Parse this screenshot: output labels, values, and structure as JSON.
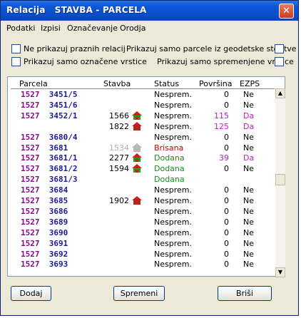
{
  "window": {
    "title": "Relacija   STAVBA - PARCELA",
    "close_glyph": "✕"
  },
  "menu": [
    "Podatki",
    "Izpisi",
    "Označevanje",
    "Orodja"
  ],
  "options": {
    "no_empty_relations": "Ne prikazuj praznih relacij",
    "only_marked_rows": "Prikazuj samo označene vrstice",
    "only_geodetic_parcels": "Prikazuj samo parcele iz geodetske storitve",
    "only_changed_rows": "Prikazuj samo spremenjene vrstice"
  },
  "columns": {
    "parcela": "Parcela",
    "stavba": "Stavba",
    "status": "Status",
    "povrsina": "Površina",
    "ezps": "EZPS"
  },
  "colors": {
    "parcel_ko": "#8a0a8a",
    "parcel_num": "#1a1a9a",
    "status_default": "#000000",
    "status_deleted": "#cc0000",
    "status_added": "#1a8a1a",
    "da": "#c020c0",
    "house_red": "#d21b1b",
    "house_green": "#1aa01a",
    "house_grey": "#b8b8b8",
    "building_grey": "#b0b0b0"
  },
  "rows": [
    {
      "ko": "1527",
      "parcel": "3451/5",
      "building": "",
      "icon": "",
      "status": "Nesprem.",
      "status_type": "default",
      "area": "0",
      "ezps": "Ne"
    },
    {
      "ko": "1527",
      "parcel": "3451/6",
      "building": "",
      "icon": "",
      "status": "Nesprem.",
      "status_type": "default",
      "area": "0",
      "ezps": "Ne"
    },
    {
      "ko": "1527",
      "parcel": "3452/1",
      "building": "1566",
      "icon": "house-red-green",
      "status": "Nesprem.",
      "status_type": "default",
      "area": "115",
      "ezps": "Da"
    },
    {
      "ko": "",
      "parcel": "",
      "building": "1822",
      "icon": "house-red-brown",
      "status": "Nesprem.",
      "status_type": "default",
      "area": "125",
      "ezps": "Da"
    },
    {
      "ko": "1527",
      "parcel": "3680/4",
      "building": "",
      "icon": "",
      "status": "Nesprem.",
      "status_type": "default",
      "area": "0",
      "ezps": "Ne"
    },
    {
      "ko": "1527",
      "parcel": "3681",
      "building": "1534",
      "icon": "house-grey",
      "status": "Brisana",
      "status_type": "deleted",
      "area": "0",
      "ezps": "Ne",
      "building_grey": true
    },
    {
      "ko": "1527",
      "parcel": "3681/1",
      "building": "2277",
      "icon": "house-red-green",
      "status": "Dodana",
      "status_type": "added",
      "area": "39",
      "ezps": "Da"
    },
    {
      "ko": "1527",
      "parcel": "3681/2",
      "building": "1594",
      "icon": "house-red-green",
      "status": "Dodana",
      "status_type": "added",
      "area": "0",
      "ezps": "Ne"
    },
    {
      "ko": "1527",
      "parcel": "3681/3",
      "building": "",
      "icon": "",
      "status": "Dodana",
      "status_type": "added",
      "area": "",
      "ezps": ""
    },
    {
      "ko": "1527",
      "parcel": "3684",
      "building": "",
      "icon": "",
      "status": "Nesprem.",
      "status_type": "default",
      "area": "0",
      "ezps": "Ne"
    },
    {
      "ko": "1527",
      "parcel": "3685",
      "building": "1902",
      "icon": "house-red-brown",
      "status": "Nesprem.",
      "status_type": "default",
      "area": "0",
      "ezps": "Ne"
    },
    {
      "ko": "1527",
      "parcel": "3686",
      "building": "",
      "icon": "",
      "status": "Nesprem.",
      "status_type": "default",
      "area": "0",
      "ezps": "Ne"
    },
    {
      "ko": "1527",
      "parcel": "3689",
      "building": "",
      "icon": "",
      "status": "Nesprem.",
      "status_type": "default",
      "area": "0",
      "ezps": "Ne"
    },
    {
      "ko": "1527",
      "parcel": "3690",
      "building": "",
      "icon": "",
      "status": "Nesprem.",
      "status_type": "default",
      "area": "0",
      "ezps": "Ne"
    },
    {
      "ko": "1527",
      "parcel": "3691",
      "building": "",
      "icon": "",
      "status": "Nesprem.",
      "status_type": "default",
      "area": "0",
      "ezps": "Ne"
    },
    {
      "ko": "1527",
      "parcel": "3692",
      "building": "",
      "icon": "",
      "status": "Nesprem.",
      "status_type": "default",
      "area": "0",
      "ezps": "Ne"
    },
    {
      "ko": "1527",
      "parcel": "3693",
      "building": "",
      "icon": "",
      "status": "Nesprem.",
      "status_type": "default",
      "area": "0",
      "ezps": "Ne"
    }
  ],
  "scrollbar": {
    "up_glyph": "▲",
    "down_glyph": "▼"
  },
  "buttons": {
    "add": "Dodaj",
    "change": "Spremeni",
    "delete": "Briši"
  }
}
